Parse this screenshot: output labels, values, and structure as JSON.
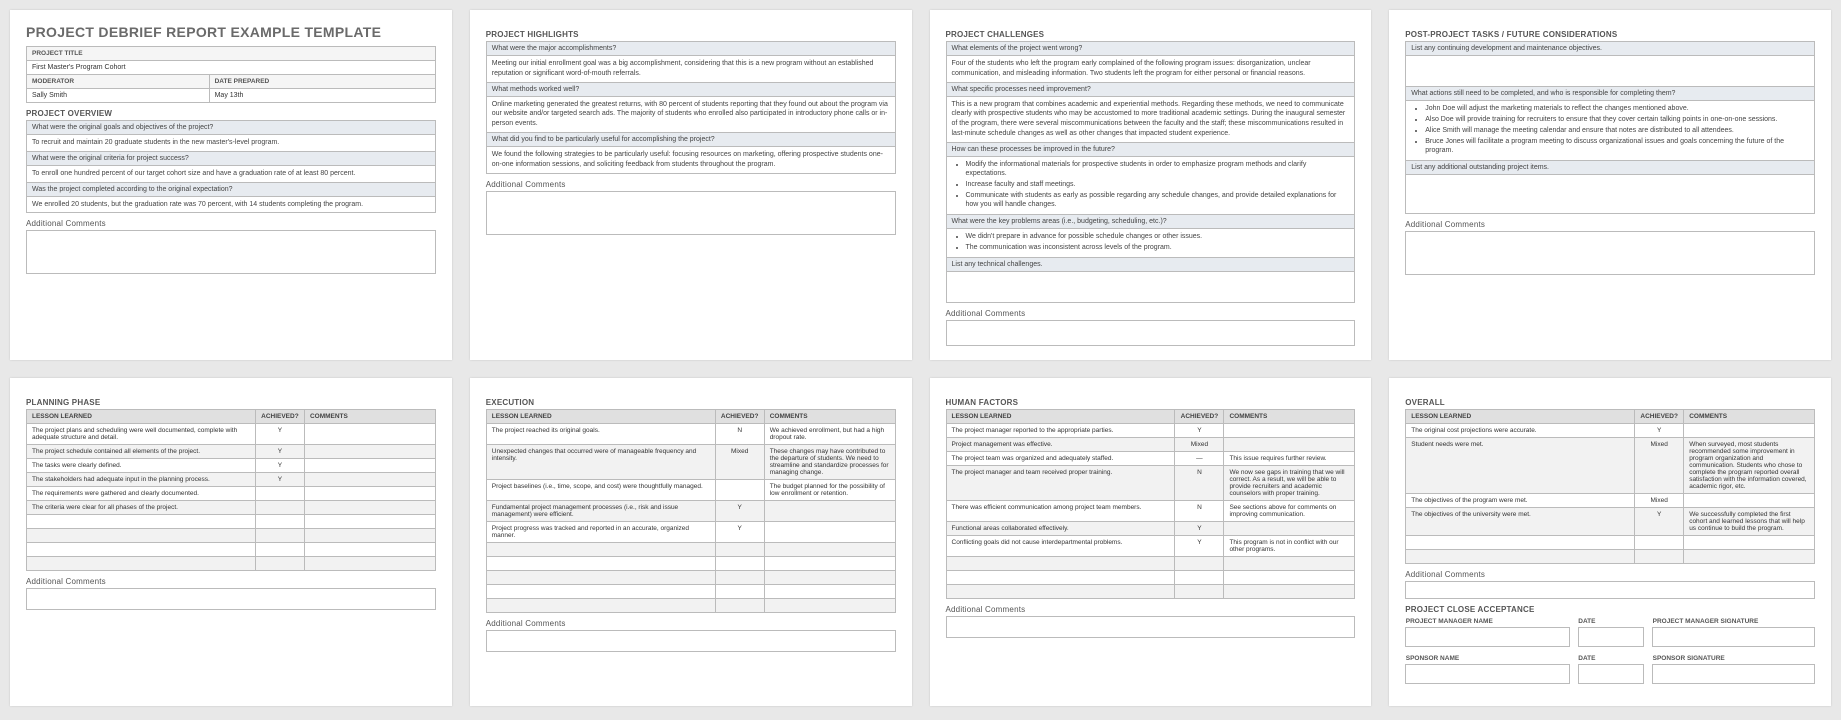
{
  "p1": {
    "mainTitle": "PROJECT DEBRIEF REPORT EXAMPLE TEMPLATE",
    "projTitleLabel": "PROJECT TITLE",
    "projTitleVal": "First Master's Program Cohort",
    "modLabel": "MODERATOR",
    "modVal": "Sally Smith",
    "dateLabel": "DATE PREPARED",
    "dateVal": "May 13th",
    "ovHead": "PROJECT OVERVIEW",
    "q1": "What were the original goals and objectives of the project?",
    "a1": "To recruit and maintain 20 graduate students in the new master's-level program.",
    "q2": "What were the original criteria for project success?",
    "a2": "To enroll one hundred percent of our target cohort size and have a graduation rate of at least 80 percent.",
    "q3": "Was the project completed according to the original expectation?",
    "a3": "We enrolled 20 students, but the graduation rate was 70 percent, with 14 students completing the program.",
    "ac": "Additional Comments"
  },
  "p2": {
    "head": "PROJECT HIGHLIGHTS",
    "q1": "What were the major accomplishments?",
    "a1": "Meeting our initial enrollment goal was a big accomplishment, considering that this is a new program without an established reputation or significant word-of-mouth referrals.",
    "q2": "What methods worked well?",
    "a2": "Online marketing generated the greatest returns, with 80 percent of students reporting that they found out about the program via our website and/or targeted search ads. The majority of students who enrolled also participated in introductory phone calls or in-person events.",
    "q3": "What did you find to be particularly useful for accomplishing the project?",
    "a3": "We found the following strategies to be particularly useful: focusing resources on marketing, offering prospective students one-on-one information sessions, and soliciting feedback from students throughout the program.",
    "ac": "Additional Comments"
  },
  "p3": {
    "head": "PROJECT CHALLENGES",
    "q1": "What elements of the project went wrong?",
    "a1": "Four of the students who left the program early complained of the following program issues: disorganization, unclear communication, and misleading information. Two students left the program for either personal or financial reasons.",
    "q2": "What specific processes need improvement?",
    "a2": "This is a new program that combines academic and experiential methods. Regarding these methods, we need to communicate clearly with prospective students who may be accustomed to more traditional academic settings. During the inaugural semester of the program, there were several miscommunications between the faculty and the staff; these miscommunications resulted in last-minute schedule changes as well as other changes that impacted student experience.",
    "q3": "How can these processes be improved in the future?",
    "b3": [
      "Modify the informational materials for prospective students in order to emphasize program methods and clarify expectations.",
      "Increase faculty and staff meetings.",
      "Communicate with students as early as possible regarding any schedule changes, and provide detailed explanations for how you will handle changes."
    ],
    "q4": "What were the key problems areas (i.e., budgeting, scheduling, etc.)?",
    "b4": [
      "We didn't prepare in advance for possible schedule changes or other issues.",
      "The communication was inconsistent across levels of the program."
    ],
    "q5": "List any technical challenges.",
    "ac": "Additional Comments"
  },
  "p4": {
    "head": "POST-PROJECT TASKS / FUTURE CONSIDERATIONS",
    "q1": "List any continuing development and maintenance objectives.",
    "q2": "What actions still need to be completed, and who is responsible for completing them?",
    "b2": [
      "John Doe will adjust the marketing materials to reflect the changes mentioned above.",
      "Also Doe will provide training for recruiters to ensure that they cover certain talking points in one-on-one sessions.",
      "Alice Smith will manage the meeting calendar and ensure that notes are distributed to all attendees.",
      "Bruce Jones will facilitate a program meeting to discuss organizational issues and goals concerning the future of the program."
    ],
    "q3": "List any additional outstanding project items.",
    "ac": "Additional Comments"
  },
  "lessons": {
    "h1": "LESSON LEARNED",
    "h2": "ACHIEVED?",
    "h3": "COMMENTS",
    "ac": "Additional Comments"
  },
  "p5": {
    "head": "PLANNING PHASE",
    "rows": [
      {
        "l": "The project plans and scheduling were well documented, complete with adequate structure and detail.",
        "a": "Y",
        "c": ""
      },
      {
        "l": "The project schedule contained all elements of the project.",
        "a": "Y",
        "c": ""
      },
      {
        "l": "The tasks were clearly defined.",
        "a": "Y",
        "c": ""
      },
      {
        "l": "The stakeholders had adequate input in the planning process.",
        "a": "Y",
        "c": ""
      },
      {
        "l": "The requirements were gathered and clearly documented.",
        "a": "",
        "c": ""
      },
      {
        "l": "The criteria were clear for all phases of the project.",
        "a": "",
        "c": ""
      },
      {
        "l": "",
        "a": "",
        "c": ""
      },
      {
        "l": "",
        "a": "",
        "c": ""
      },
      {
        "l": "",
        "a": "",
        "c": ""
      },
      {
        "l": "",
        "a": "",
        "c": ""
      }
    ]
  },
  "p6": {
    "head": "EXECUTION",
    "rows": [
      {
        "l": "The project reached its original goals.",
        "a": "N",
        "c": "We achieved enrollment, but had a high dropout rate."
      },
      {
        "l": "Unexpected changes that occurred were of manageable frequency and intensity.",
        "a": "Mixed",
        "c": "These changes may have contributed to the departure of students. We need to streamline and standardize processes for managing change."
      },
      {
        "l": "Project baselines (i.e., time, scope, and cost) were thoughtfully managed.",
        "a": "",
        "c": "The budget planned for the possibility of low enrollment or retention."
      },
      {
        "l": "Fundamental project management processes (i.e., risk and issue management) were efficient.",
        "a": "Y",
        "c": ""
      },
      {
        "l": "Project progress was tracked and reported in an accurate, organized manner.",
        "a": "Y",
        "c": ""
      },
      {
        "l": "",
        "a": "",
        "c": ""
      },
      {
        "l": "",
        "a": "",
        "c": ""
      },
      {
        "l": "",
        "a": "",
        "c": ""
      },
      {
        "l": "",
        "a": "",
        "c": ""
      },
      {
        "l": "",
        "a": "",
        "c": ""
      }
    ]
  },
  "p7": {
    "head": "HUMAN FACTORS",
    "rows": [
      {
        "l": "The project manager reported to the appropriate parties.",
        "a": "Y",
        "c": ""
      },
      {
        "l": "Project management was effective.",
        "a": "Mixed",
        "c": ""
      },
      {
        "l": "The project team was organized and adequately staffed.",
        "a": "—",
        "c": "This issue requires further review."
      },
      {
        "l": "The project manager and team received proper training.",
        "a": "N",
        "c": "We now see gaps in training that we will correct. As a result, we will be able to provide recruiters and academic counselors with proper training."
      },
      {
        "l": "There was efficient communication among project team members.",
        "a": "N",
        "c": "See sections above for comments on improving communication."
      },
      {
        "l": "Functional areas collaborated effectively.",
        "a": "Y",
        "c": ""
      },
      {
        "l": "Conflicting goals did not cause interdepartmental problems.",
        "a": "Y",
        "c": "This program is not in conflict with our other programs."
      },
      {
        "l": "",
        "a": "",
        "c": ""
      },
      {
        "l": "",
        "a": "",
        "c": ""
      },
      {
        "l": "",
        "a": "",
        "c": ""
      }
    ]
  },
  "p8": {
    "head": "OVERALL",
    "rows": [
      {
        "l": "The original cost projections were accurate.",
        "a": "Y",
        "c": ""
      },
      {
        "l": "Student needs were met.",
        "a": "Mixed",
        "c": "When surveyed, most students recommended some improvement in program organization and communication. Students who chose to complete the program reported overall satisfaction with the information covered, academic rigor, etc."
      },
      {
        "l": "The objectives of the program were met.",
        "a": "Mixed",
        "c": ""
      },
      {
        "l": "The objectives of the university were met.",
        "a": "Y",
        "c": "We successfully completed the first cohort and learned lessons that will help us continue to build the program."
      },
      {
        "l": "",
        "a": "",
        "c": ""
      },
      {
        "l": "",
        "a": "",
        "c": ""
      }
    ],
    "closeHead": "PROJECT CLOSE ACCEPTANCE",
    "pmName": "PROJECT MANAGER NAME",
    "date": "DATE",
    "pmSig": "PROJECT MANAGER SIGNATURE",
    "spName": "SPONSOR NAME",
    "spSig": "SPONSOR SIGNATURE"
  }
}
